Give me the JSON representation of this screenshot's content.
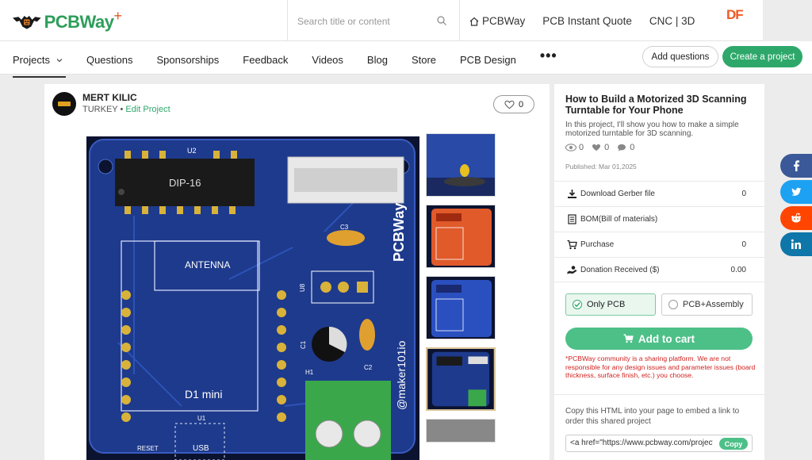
{
  "header": {
    "logo_text": "PCBWay",
    "logo_plus": "+",
    "search_placeholder": "Search title or content",
    "nav": [
      {
        "label": "PCBWay",
        "icon": "home-icon"
      },
      {
        "label": "PCB Instant Quote"
      },
      {
        "label": "CNC | 3D"
      }
    ],
    "df_logo": "DF"
  },
  "subnav": {
    "items": [
      "Projects",
      "Questions",
      "Sponsorships",
      "Feedback",
      "Videos",
      "Blog",
      "Store",
      "PCB Design"
    ],
    "more": "•••",
    "add_questions": "Add questions",
    "create_project": "Create a project"
  },
  "author": {
    "name": "MERT KILIC",
    "country": "TURKEY",
    "separator": " • ",
    "edit": "Edit Project",
    "likes": "0"
  },
  "pcb": {
    "labels": {
      "u2": "U2",
      "dip": "DIP-16",
      "antenna": "ANTENNA",
      "d1mini": "D1 mini",
      "u1": "U1",
      "reset": "RESET",
      "usb": "USB",
      "u8": "U8",
      "c1": "C1",
      "c2": "C2",
      "c3": "C3",
      "h1": "H1",
      "brand": "PCBWay",
      "handle": "@maker101io"
    }
  },
  "project": {
    "title": "How to Build a Motorized 3D Scanning Turntable for Your Phone",
    "description": "In this project, I'll show you how to make a simple motorized turntable for 3D scanning.",
    "views": "0",
    "likes": "0",
    "comments": "0",
    "published": "Published: Mar 01,2025"
  },
  "rows": [
    {
      "label": "Download Gerber file",
      "value": "0",
      "icon": "download-icon"
    },
    {
      "label": "BOM(Bill of materials)",
      "value": "",
      "icon": "document-icon"
    },
    {
      "label": "Purchase",
      "value": "0",
      "icon": "cart-icon"
    },
    {
      "label": "Donation Received ($)",
      "value": "0.00",
      "icon": "donation-icon"
    }
  ],
  "options": {
    "only_pcb": "Only PCB",
    "pcb_assembly": "PCB+Assembly"
  },
  "cart": {
    "label": "Add to cart"
  },
  "disclaimer": "*PCBWay community is a sharing platform. We are not responsible for any design issues and parameter issues (board thickness, surface finish, etc.) you choose.",
  "embed": {
    "text": "Copy this HTML into your page to embed a link to order this shared project",
    "code": "<a href=\"https://www.pcbway.com/project",
    "copy": "Copy"
  },
  "colors": {
    "brand_green": "#2ea86a",
    "cart_green": "#4dc088",
    "pcb_blue": "#1c3a8c",
    "facebook": "#3b5998",
    "twitter": "#1da1f2",
    "reddit": "#ff4500",
    "linkedin": "#0e76a8"
  }
}
